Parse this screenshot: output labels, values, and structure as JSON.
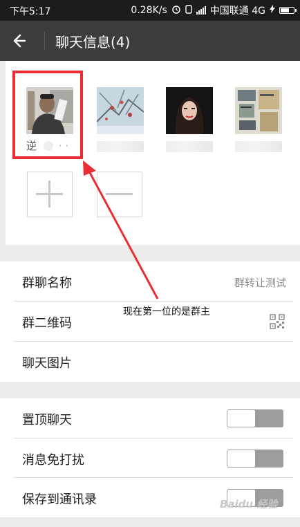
{
  "status_bar": {
    "time": "下午5:17",
    "net_speed": "0.28K/s",
    "carrier": "中国联通 4G"
  },
  "header": {
    "title": "聊天信息(4)"
  },
  "members": [
    {
      "name": "逆",
      "icon": "person-photo"
    },
    {
      "name": "",
      "icon": "frosted-branches-photo"
    },
    {
      "name": "",
      "icon": "woman-portrait-photo"
    },
    {
      "name": "",
      "icon": "poster-photo"
    }
  ],
  "member_actions": [
    {
      "icon": "plus-icon"
    },
    {
      "icon": "minus-icon"
    }
  ],
  "annotation": {
    "text": "现在第一位的是群主",
    "color": "#ec2c34"
  },
  "settings": {
    "group_name_label": "群聊名称",
    "group_name_value": "群转让测试",
    "qr_code_label": "群二维码",
    "chat_images_label": "聊天图片",
    "pin_label": "置顶聊天",
    "mute_label": "消息免打扰",
    "save_contacts_label": "保存到通讯录"
  },
  "watermark": "Baidu 经验",
  "colors": {
    "accent": "#ec2c34",
    "header_bg": "#3c3c3c",
    "status_bg": "#1c1c1c"
  }
}
